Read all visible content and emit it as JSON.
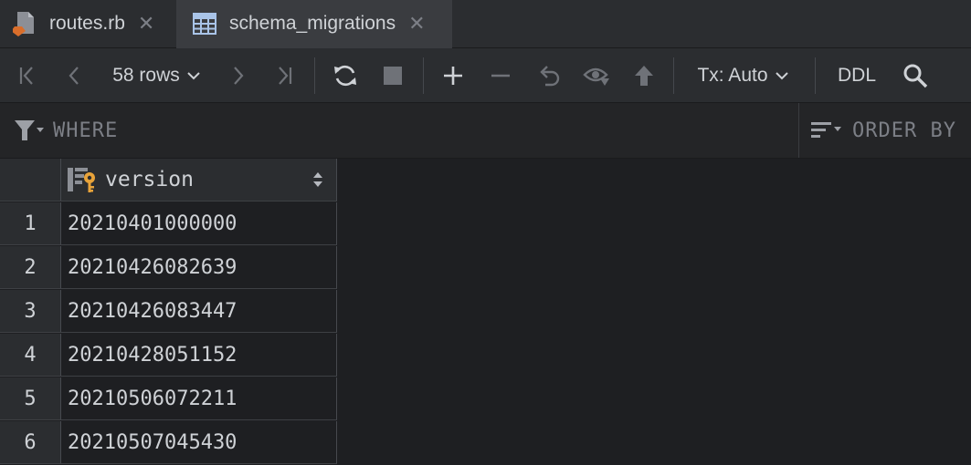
{
  "tabs": [
    {
      "label": "routes.rb",
      "icon": "ruby-file-icon"
    },
    {
      "label": "schema_migrations",
      "icon": "table-icon"
    }
  ],
  "toolbar": {
    "rows_label": "58 rows",
    "tx_label": "Tx: Auto",
    "ddl_label": "DDL"
  },
  "filter": {
    "where_label": "WHERE",
    "order_by_label": "ORDER BY"
  },
  "table": {
    "column": "version",
    "rows": [
      {
        "n": "1",
        "v": "20210401000000"
      },
      {
        "n": "2",
        "v": "20210426082639"
      },
      {
        "n": "3",
        "v": "20210426083447"
      },
      {
        "n": "4",
        "v": "20210428051152"
      },
      {
        "n": "5",
        "v": "20210506072211"
      },
      {
        "n": "6",
        "v": "20210507045430"
      }
    ]
  },
  "colors": {
    "accent_orange": "#d96e2b",
    "key_yellow": "#e8a33a"
  }
}
